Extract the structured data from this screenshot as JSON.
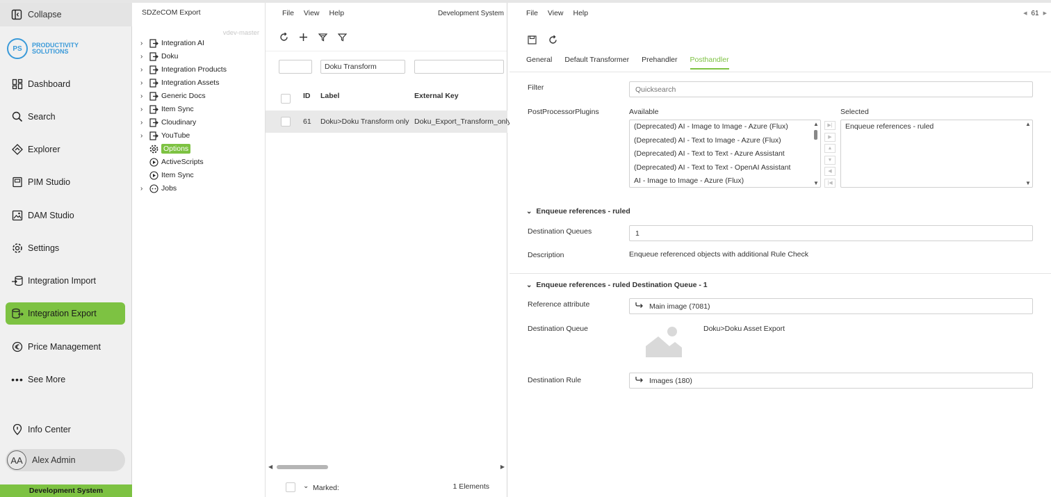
{
  "nav": {
    "collapse": "Collapse",
    "logo_initials": "PS",
    "logo_line1": "PRODUCTIVITY",
    "logo_line2": "SOLUTIONS",
    "items": [
      {
        "label": "Dashboard",
        "icon": "dashboard-icon"
      },
      {
        "label": "Search",
        "icon": "search-icon"
      },
      {
        "label": "Explorer",
        "icon": "explorer-icon"
      },
      {
        "label": "PIM Studio",
        "icon": "pim-studio-icon"
      },
      {
        "label": "DAM Studio",
        "icon": "dam-studio-icon"
      },
      {
        "label": "Settings",
        "icon": "gear-icon"
      },
      {
        "label": "Integration Import",
        "icon": "import-icon"
      },
      {
        "label": "Integration Export",
        "icon": "export-icon",
        "active": true
      },
      {
        "label": "Price Management",
        "icon": "euro-icon"
      },
      {
        "label": "See More",
        "icon": "more-icon"
      }
    ],
    "info_center": "Info Center",
    "user_initials": "AA",
    "user_name": "Alex Admin",
    "environment": "Development System"
  },
  "tree": {
    "title": "SDZeCOM Export",
    "branch": "vdev-master",
    "nodes": [
      {
        "label": "Integration AI",
        "expandable": true
      },
      {
        "label": "Doku",
        "expandable": true
      },
      {
        "label": "Integration Products",
        "expandable": true
      },
      {
        "label": "Integration Assets",
        "expandable": true
      },
      {
        "label": "Generic Docs",
        "expandable": true
      },
      {
        "label": "Item Sync",
        "expandable": true
      },
      {
        "label": "Cloudinary",
        "expandable": true
      },
      {
        "label": "YouTube",
        "expandable": true
      },
      {
        "label": "Options",
        "selected": true
      },
      {
        "label": "ActiveScripts"
      },
      {
        "label": "Item Sync"
      },
      {
        "label": "Jobs",
        "expandable": true
      }
    ]
  },
  "list": {
    "menu": [
      "File",
      "View",
      "Help"
    ],
    "environment": "Development System",
    "filter_label_value": "Doku Transform",
    "columns": {
      "id": "ID",
      "label": "Label",
      "external_key": "External Key"
    },
    "rows": [
      {
        "id": "61",
        "label": "Doku>Doku Transform only",
        "external_key": "Doku_Export_Transform_only"
      }
    ],
    "footer_marked": "Marked:",
    "footer_count": "1 Elements"
  },
  "detail": {
    "menu": [
      "File",
      "View",
      "Help"
    ],
    "record_id": "61",
    "tabs": [
      "General",
      "Default Transformer",
      "Prehandler",
      "Posthandler"
    ],
    "active_tab": "Posthandler",
    "filter_label": "Filter",
    "filter_placeholder": "Quicksearch",
    "plugins_label": "PostProcessorPlugins",
    "available_label": "Available",
    "selected_label": "Selected",
    "available": [
      "(Deprecated) AI - Image to Image - Azure (Flux)",
      "(Deprecated) AI - Text to Image - Azure (Flux)",
      "(Deprecated) AI - Text to Text - Azure Assistant",
      "(Deprecated) AI - Text to Text - OpenAI Assistant",
      "AI - Image to Image - Azure (Flux)"
    ],
    "selected": [
      "Enqueue references - ruled"
    ],
    "section1": {
      "title": "Enqueue references - ruled",
      "dest_queues_label": "Destination Queues",
      "dest_queues_value": "1",
      "description_label": "Description",
      "description_value": "Enqueue referenced objects with additional Rule Check"
    },
    "section2": {
      "title": "Enqueue references - ruled Destination Queue - 1",
      "ref_attr_label": "Reference attribute",
      "ref_attr_value": "Main image (7081)",
      "dest_queue_label": "Destination Queue",
      "dest_queue_value": "Doku>Doku Asset Export",
      "dest_rule_label": "Destination Rule",
      "dest_rule_value": "Images (180)"
    }
  },
  "colors": {
    "accent": "#7dc242",
    "logo": "#3a9ad9"
  }
}
